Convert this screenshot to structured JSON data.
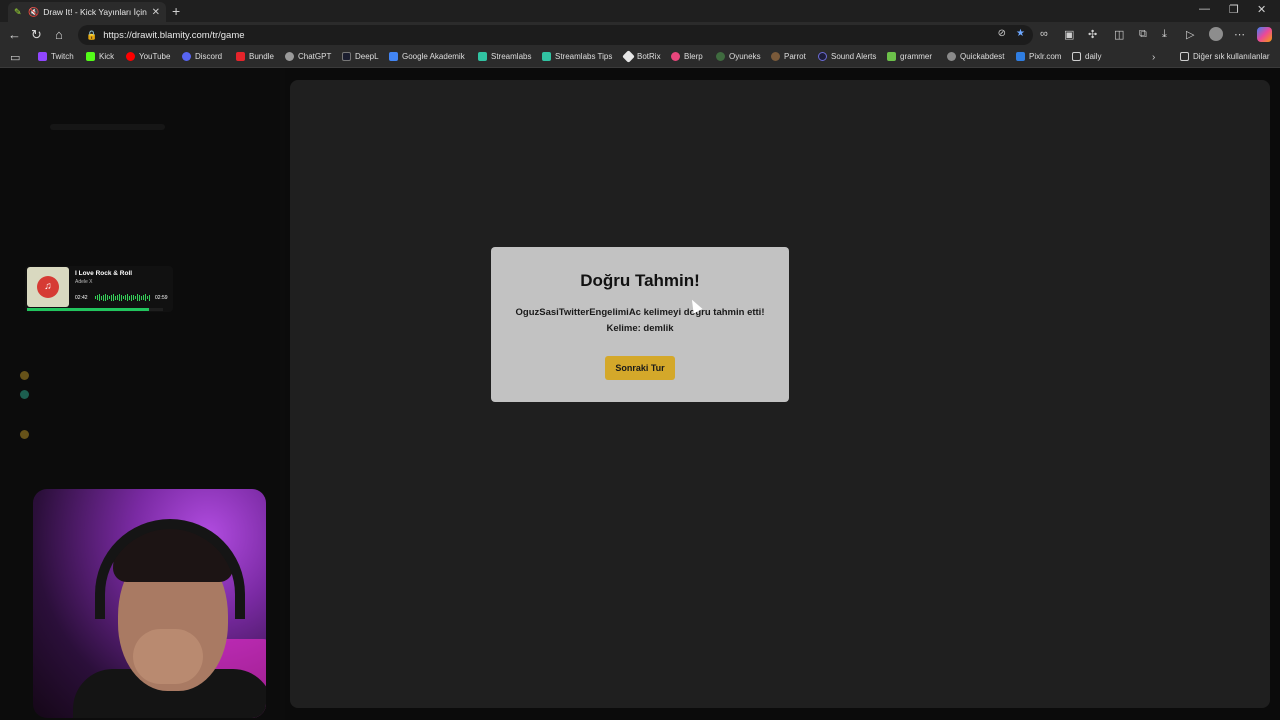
{
  "browser": {
    "tab_title": "Draw It! - Kick Yayınları İçin Ç",
    "url": "https://drawit.blamity.com/tr/game",
    "bookmarks": [
      "Twitch",
      "Kick",
      "YouTube",
      "Discord",
      "Bundle",
      "ChatGPT",
      "DeepL",
      "Google Akademik",
      "Streamlabs",
      "Streamlabs Tips",
      "BotRix",
      "Blerp",
      "Oyuneks",
      "Parrot",
      "Sound Alerts",
      "grammer",
      "Quickabdest",
      "Pixlr.com",
      "daily"
    ],
    "other_bookmarks": "Diğer sık kullanılanlar"
  },
  "now_playing": {
    "title": "I Love Rock & Roll",
    "artist": "Adele X",
    "elapsed": "02:42",
    "total": "02:59",
    "progress": 0.9
  },
  "modal": {
    "title": "Doğru Tahmin!",
    "message": "OguzSasiTwitterEngelimiAc kelimeyi doğru tahmin etti! Kelime: demlik",
    "button": "Sonraki Tur"
  },
  "colors": {
    "accent_button": "#d4a82a",
    "modal_bg": "#c2c2c2",
    "progress": "#22c55e"
  }
}
